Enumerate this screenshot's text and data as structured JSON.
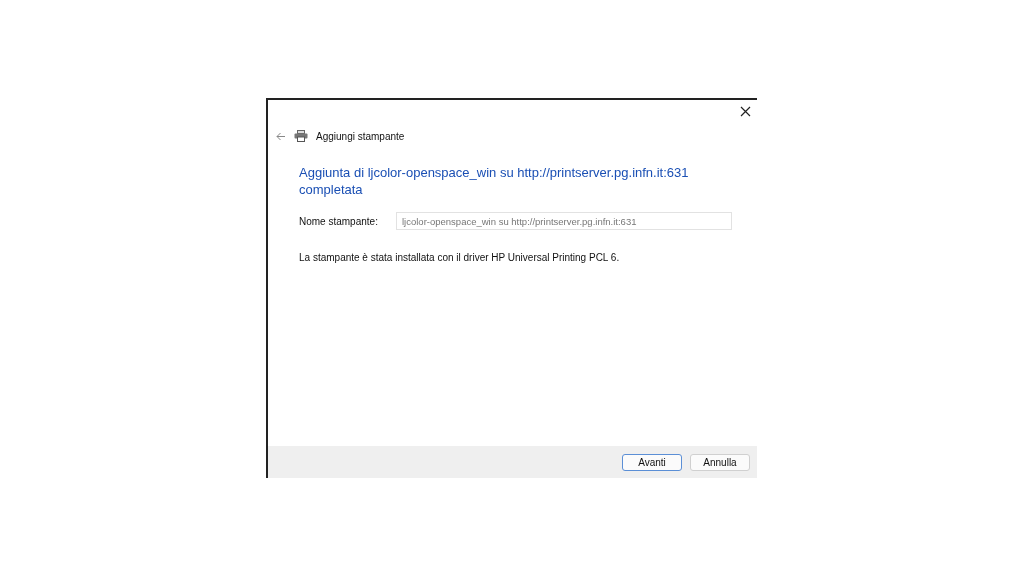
{
  "wizard": {
    "title": "Aggiungi stampante",
    "heading": "Aggiunta di ljcolor-openspace_win su http://printserver.pg.infn.it:631 completata",
    "field": {
      "label": "Nome stampante:",
      "value": "ljcolor-openspace_win su http://printserver.pg.infn.it:631",
      "disabled": true
    },
    "message": "La stampante è stata installata con il driver HP Universal Printing PCL 6.",
    "buttons": [
      {
        "label": "Avanti",
        "default": true
      },
      {
        "label": "Annulla",
        "default": false
      }
    ]
  }
}
